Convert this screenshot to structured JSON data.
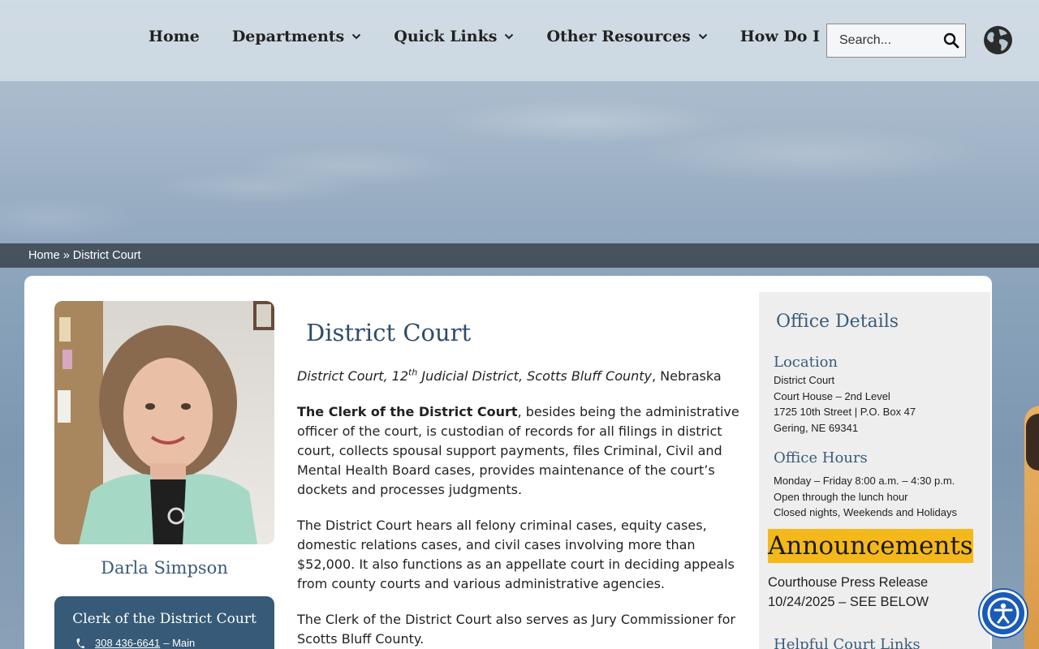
{
  "nav": {
    "items": [
      {
        "label": "Home",
        "dropdown": false
      },
      {
        "label": "Departments",
        "dropdown": true
      },
      {
        "label": "Quick Links",
        "dropdown": true
      },
      {
        "label": "Other Resources",
        "dropdown": true
      },
      {
        "label": "How Do I",
        "dropdown": true
      }
    ],
    "search_placeholder": "Search..."
  },
  "breadcrumb": {
    "home": "Home",
    "separator": "»",
    "current": "District Court"
  },
  "profile": {
    "name": "Darla Simpson",
    "role": "Clerk of the District Court",
    "phone": "308 436-6641",
    "phone_suffix": "– Main"
  },
  "main": {
    "title": "District Court",
    "intro_italic_1": "District Court, 12",
    "intro_sup": "th",
    "intro_italic_2": " Judicial District, Scotts Bluff County",
    "intro_tail": ", Nebraska",
    "p1_bold": "The Clerk of the District Court",
    "p1_text": ", besides being the administrative officer of the court, is custodian of records for all filings in district court, collects spousal support payments, files Criminal, Civil and Mental Health Board cases, provides maintenance of the court’s dockets and processes judgments.",
    "p2": "The District Court hears all felony criminal cases, equity cases, domestic relations cases, and civil cases involving more than $52,000. It also functions as an appellate court in deciding appeals from county courts and various administrative agencies.",
    "p3": "The Clerk of the District Court also serves as Jury Commissioner for Scotts Bluff County."
  },
  "sidebar": {
    "title": "Office Details",
    "location_heading": "Location",
    "location_lines": [
      "District Court",
      "Court House – 2nd Level",
      "1725 10th Street | P.O. Box 47",
      "Gering, NE 69341"
    ],
    "hours_heading": "Office Hours",
    "hours_lines": [
      "Monday – Friday 8:00 a.m. – 4:30 p.m.",
      "Open through the lunch hour",
      "Closed nights, Weekends and Holidays"
    ],
    "announcements_heading": "Announcements",
    "announcement_lines": [
      "Courthouse Press Release",
      "10/24/2025 – SEE BELOW"
    ],
    "helpful_heading": "Helpful Court Links"
  },
  "colors": {
    "accent": "#3b5b7a",
    "announcement_highlight": "#f5b81a",
    "role_box": "#365a78",
    "breadcrumb_bar": "#3c4852",
    "a11y_button": "#1a5bb8"
  },
  "icons": {
    "search": "search-icon",
    "globe": "globe-icon",
    "chevron": "chevron-down-icon",
    "phone": "phone-icon",
    "accessibility": "accessibility-icon"
  }
}
